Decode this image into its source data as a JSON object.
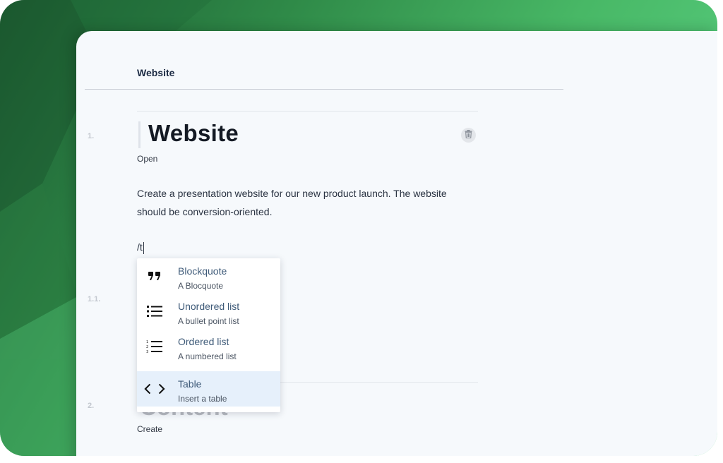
{
  "breadcrumb": {
    "label": "Website"
  },
  "sections": [
    {
      "number": "1.",
      "title": "Website",
      "status": "Open",
      "description": "Create a presentation website for our new product launch. The website should be conversion-oriented."
    },
    {
      "number": "1.1."
    },
    {
      "number": "2.",
      "title": "Content",
      "status": "Create"
    }
  ],
  "editor": {
    "command_text": "/t"
  },
  "slash_menu": {
    "items": [
      {
        "icon": "quote-icon",
        "label": "Blockquote",
        "sub": "A Blocquote"
      },
      {
        "icon": "bullet-list-icon",
        "label": "Unordered list",
        "sub": "A bullet point list"
      },
      {
        "icon": "numbered-list-icon",
        "label": "Ordered list",
        "sub": "A numbered list"
      },
      {
        "icon": "code-brackets-icon",
        "label": "Table",
        "sub": "Insert a table",
        "highlighted": true
      }
    ]
  },
  "colors": {
    "accent_green": "#48b866",
    "highlight": "#e6f0fb",
    "title": "#141a24"
  }
}
